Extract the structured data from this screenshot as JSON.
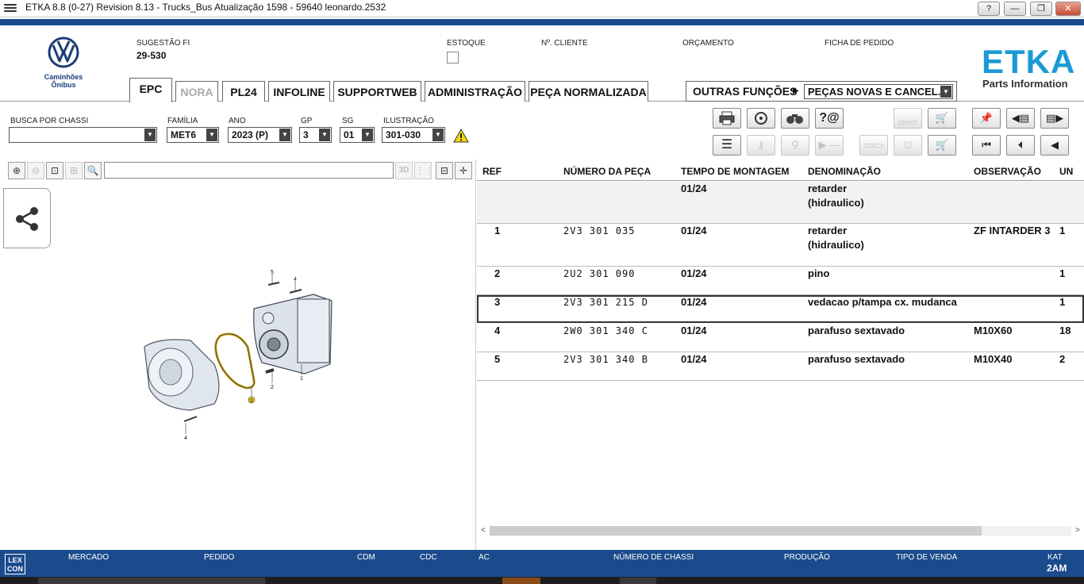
{
  "window": {
    "title": "ETKA 8.8 (0-27) Revision 8.13 - Trucks_Bus Atualização 1598 - 59640 leonardo.2532",
    "help_label": "?",
    "minimize_label": "—",
    "restore_label": "❐",
    "close_label": "✕"
  },
  "brand": {
    "name": "Caminhões Ônibus",
    "etka_logo": "ETKA",
    "etka_tagline": "Parts Information"
  },
  "header": {
    "sugestao_label": "SUGESTÃO FI",
    "sugestao_value": "29-530",
    "estoque_label": "ESTOQUE",
    "cliente_label": "Nº. CLIENTE",
    "orcamento_label": "ORÇAMENTO",
    "ficha_label": "FICHA DE PEDIDO"
  },
  "tabs": [
    {
      "label": "EPC",
      "active": true
    },
    {
      "label": "NORA",
      "disabled": true
    },
    {
      "label": "PL24"
    },
    {
      "label": "INFOLINE"
    },
    {
      "label": "SUPPORTWEB"
    },
    {
      "label": "ADMINISTRAÇÃO"
    },
    {
      "label": "PEÇA NORMALIZADA"
    }
  ],
  "other_functions": {
    "label": "OUTRAS FUNÇÕES",
    "selected": "PEÇAS NOVAS E CANCEL."
  },
  "filters": {
    "chassi_label": "BUSCA POR CHASSI",
    "chassi_value": "",
    "familia_label": "FAMÍLIA",
    "familia_value": "MET6",
    "ano_label": "ANO",
    "ano_value": "2023 (P)",
    "gp_label": "GP",
    "gp_value": "3",
    "sg_label": "SG",
    "sg_value": "01",
    "ilustracao_label": "ILUSTRAÇÃO",
    "ilustracao_value": "301-030"
  },
  "toolbar": {
    "depot_label": "DEPOT"
  },
  "table": {
    "columns": [
      "REF",
      "NÚMERO DA PEÇA",
      "TEMPO DE MONTAGEM",
      "DENOMINAÇÃO",
      "OBSERVAÇÃO",
      "UN"
    ],
    "header_row": {
      "tempo": "01/24",
      "denominacao": "retarder",
      "denominacao2": "(hidraulico)"
    },
    "rows": [
      {
        "ref": "1",
        "numero": "2V3 301 035",
        "tempo": "01/24",
        "denominacao": "retarder",
        "denominacao2": "(hidraulico)",
        "observacao": "ZF INTARDER 3",
        "un": "1"
      },
      {
        "ref": "2",
        "numero": "2U2 301 090",
        "tempo": "01/24",
        "denominacao": "pino",
        "denominacao2": "",
        "observacao": "",
        "un": "1"
      },
      {
        "ref": "3",
        "numero": "2V3 301 215 D",
        "tempo": "01/24",
        "denominacao": "vedacao p/tampa cx. mudanca",
        "denominacao2": "",
        "observacao": "",
        "un": "1"
      },
      {
        "ref": "4",
        "numero": "2W0 301 340 C",
        "tempo": "01/24",
        "denominacao": "parafuso sextavado",
        "denominacao2": "",
        "observacao": "M10X60",
        "un": "18"
      },
      {
        "ref": "5",
        "numero": "2V3 301 340 B",
        "tempo": "01/24",
        "denominacao": "parafuso sextavado",
        "denominacao2": "",
        "observacao": "M10X40",
        "un": "2"
      }
    ]
  },
  "illustration": {
    "callouts": [
      "5",
      "4",
      "1",
      "2",
      "3",
      "4"
    ]
  },
  "statusbar": {
    "logo": "LEX CON",
    "mercado_label": "MERCADO",
    "pedido_label": "PEDIDO",
    "cdm_label": "CDM",
    "cdc_label": "CDC",
    "ac_label": "AC",
    "chassi_label": "NÚMERO DE CHASSI",
    "producao_label": "PRODUÇÃO",
    "venda_label": "TIPO DE VENDA",
    "kat_label": "KAT",
    "kat_value": "2AM"
  },
  "colors": {
    "brand_blue": "#1b4b8c",
    "etka_blue": "#1a9ad6"
  }
}
